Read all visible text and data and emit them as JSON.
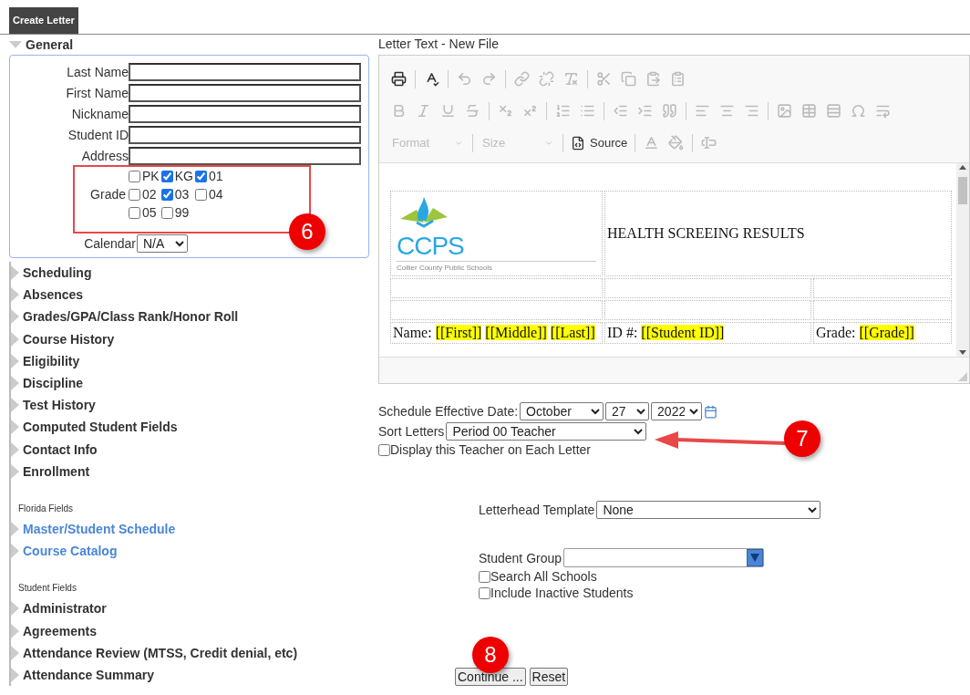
{
  "tab": {
    "label": "Create Letter",
    "selected": true
  },
  "general": {
    "title": "General",
    "expanded": true,
    "fields": [
      {
        "label": "Last Name"
      },
      {
        "label": "First Name"
      },
      {
        "label": "Nickname"
      },
      {
        "label": "Student ID"
      },
      {
        "label": "Address"
      }
    ],
    "grade": {
      "label": "Grade",
      "options": [
        {
          "label": "PK",
          "checked": false
        },
        {
          "label": "KG",
          "checked": true
        },
        {
          "label": "01",
          "checked": true
        },
        {
          "label": "02",
          "checked": false
        },
        {
          "label": "03",
          "checked": true
        },
        {
          "label": "04",
          "checked": false
        },
        {
          "label": "05",
          "checked": false
        },
        {
          "label": "99",
          "checked": false
        }
      ]
    },
    "calendar": {
      "label": "Calendar",
      "value": "N/A"
    }
  },
  "sections": [
    {
      "items": [
        {
          "label": "Scheduling",
          "kind": "plain"
        },
        {
          "label": "Absences",
          "kind": "plain"
        },
        {
          "label": "Grades/GPA/Class Rank/Honor Roll",
          "kind": "plain"
        },
        {
          "label": "Course History",
          "kind": "plain"
        },
        {
          "label": "Eligibility",
          "kind": "plain"
        },
        {
          "label": "Discipline",
          "kind": "plain"
        },
        {
          "label": "Test History",
          "kind": "plain"
        },
        {
          "label": "Computed Student Fields",
          "kind": "plain"
        },
        {
          "label": "Contact Info",
          "kind": "plain"
        },
        {
          "label": "Enrollment",
          "kind": "plain"
        }
      ]
    },
    {
      "heading": "Florida Fields",
      "items": [
        {
          "label": "Master/Student Schedule",
          "kind": "link"
        },
        {
          "label": "Course Catalog",
          "kind": "link"
        }
      ]
    },
    {
      "heading": "Student Fields",
      "items": [
        {
          "label": "Administrator",
          "kind": "plain"
        },
        {
          "label": "Agreements",
          "kind": "plain"
        },
        {
          "label": "Attendance Review (MTSS, Credit denial, etc)",
          "kind": "plain"
        },
        {
          "label": "Attendance Summary",
          "kind": "plain"
        }
      ]
    }
  ],
  "editor": {
    "title": "Letter Text - New File",
    "toolbar": [
      [
        {
          "kind": "print",
          "disabled": false
        },
        {
          "kind": "separator"
        },
        {
          "kind": "spellcheck",
          "disabled": false
        },
        {
          "kind": "separator"
        },
        {
          "kind": "undo",
          "disabled": true
        },
        {
          "kind": "redo",
          "disabled": true
        },
        {
          "kind": "separator"
        },
        {
          "kind": "link",
          "disabled": true
        },
        {
          "kind": "unlink",
          "disabled": true
        },
        {
          "kind": "remove-format",
          "disabled": true
        },
        {
          "kind": "separator"
        },
        {
          "kind": "cut",
          "disabled": true
        },
        {
          "kind": "copy",
          "disabled": true
        },
        {
          "kind": "paste",
          "disabled": true
        },
        {
          "kind": "paste-word",
          "disabled": true
        }
      ],
      [
        {
          "kind": "bold",
          "disabled": true
        },
        {
          "kind": "italic",
          "disabled": true
        },
        {
          "kind": "underline",
          "disabled": true
        },
        {
          "kind": "strike",
          "disabled": true
        },
        {
          "kind": "separator"
        },
        {
          "kind": "subscript",
          "disabled": true
        },
        {
          "kind": "superscript",
          "disabled": true
        },
        {
          "kind": "separator"
        },
        {
          "kind": "numbered-list",
          "disabled": true
        },
        {
          "kind": "bulleted-list",
          "disabled": true
        },
        {
          "kind": "separator"
        },
        {
          "kind": "outdent",
          "disabled": true
        },
        {
          "kind": "indent",
          "disabled": true
        },
        {
          "kind": "quote",
          "disabled": true
        },
        {
          "kind": "separator"
        },
        {
          "kind": "align-left",
          "disabled": true
        },
        {
          "kind": "align-center",
          "disabled": true
        },
        {
          "kind": "align-right",
          "disabled": true
        },
        {
          "kind": "separator"
        },
        {
          "kind": "image",
          "disabled": true
        },
        {
          "kind": "table",
          "disabled": true
        },
        {
          "kind": "horizontal-line",
          "disabled": true
        },
        {
          "kind": "special-char",
          "disabled": true
        },
        {
          "kind": "page-break",
          "disabled": true
        }
      ],
      [
        {
          "kind": "combo",
          "label": "Format",
          "disabled": true
        },
        {
          "kind": "separator"
        },
        {
          "kind": "combo",
          "label": "Size",
          "disabled": true
        },
        {
          "kind": "separator"
        },
        {
          "kind": "source",
          "label": "Source",
          "disabled": false
        },
        {
          "kind": "separator"
        },
        {
          "kind": "text-color",
          "disabled": true
        },
        {
          "kind": "bg-color",
          "disabled": true
        },
        {
          "kind": "separator"
        },
        {
          "kind": "form-field",
          "disabled": true
        }
      ]
    ],
    "document": {
      "logo": {
        "name": "CCPS",
        "tagline": "Collier County Public Schools"
      },
      "title": "HEALTH SCREEING RESULTS",
      "cells": [
        {
          "label": "Name:",
          "merge_fields": [
            "[[First]]",
            "[[Middle]]",
            "[[Last]]"
          ]
        },
        {
          "label": "ID #:",
          "merge_fields": [
            "[[Student ID]]"
          ]
        },
        {
          "label": "Grade:",
          "merge_fields": [
            "[[Grade]]"
          ]
        }
      ]
    }
  },
  "schedule": {
    "label": "Schedule Effective Date:",
    "month": "October",
    "day": "27",
    "year": "2022"
  },
  "sort": {
    "label": "Sort Letters",
    "value": "Period 00 Teacher"
  },
  "display_teacher": {
    "label": "Display this Teacher on Each Letter",
    "checked": false
  },
  "letterhead": {
    "label": "Letterhead Template",
    "value": "None"
  },
  "student_group": {
    "label": "Student Group"
  },
  "options": [
    {
      "label": "Search All Schools",
      "checked": false
    },
    {
      "label": "Include Inactive Students",
      "checked": false
    }
  ],
  "buttons": [
    {
      "label": "Continue ..."
    },
    {
      "label": "Reset"
    }
  ],
  "annotations": [
    {
      "label": "6"
    },
    {
      "label": "7"
    },
    {
      "label": "8"
    }
  ]
}
